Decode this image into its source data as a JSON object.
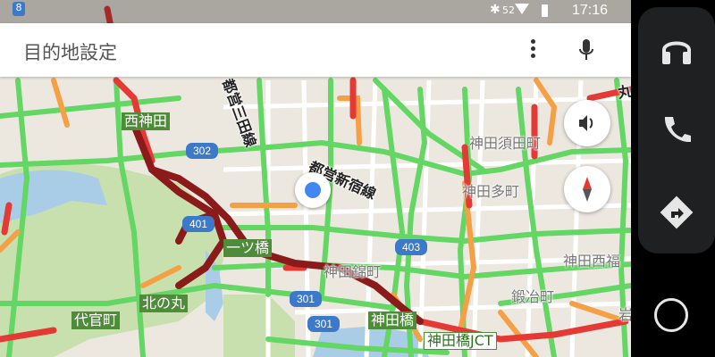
{
  "status_bar": {
    "time": "17:16",
    "left_badge": "8",
    "signal": "52"
  },
  "search": {
    "placeholder": "目的地設定"
  },
  "map": {
    "station_labels": [
      "西神田",
      "一ツ橋",
      "北の丸",
      "代官町",
      "神田橋",
      "神田橋JCT"
    ],
    "area_labels": [
      "神田須田町",
      "神田多町",
      "神田錦町",
      "神田西福",
      "鍛冶町",
      "岩"
    ],
    "line_labels": [
      "都営新宿線",
      "都営三田線",
      "丸ノ内線"
    ],
    "route_shields": [
      "302",
      "401",
      "403",
      "301",
      "301"
    ]
  },
  "colors": {
    "traffic_fast": "#63d663",
    "traffic_slow": "#f5a045",
    "traffic_jam": "#e53935",
    "traffic_stop": "#8b1b1b",
    "park": "#c8e0ae",
    "water": "#a9cde6",
    "accent": "#4285f4"
  },
  "icons": [
    "bluetooth-icon",
    "wifi-icon",
    "battery-icon",
    "more-vert-icon",
    "mic-icon",
    "volume-icon",
    "compass-icon",
    "headphones-icon",
    "phone-icon",
    "navigation-icon",
    "home-icon"
  ]
}
